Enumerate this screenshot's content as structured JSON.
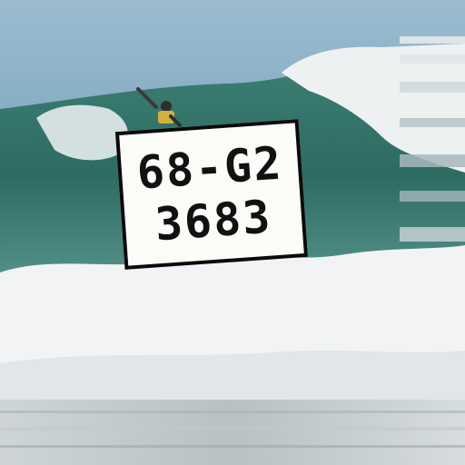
{
  "plate": {
    "line1": "68-G2",
    "line2": "3683"
  },
  "colors": {
    "sky": "#8fb3c9",
    "wave_dark": "#2f6f66",
    "wave_mid": "#4f8c84",
    "foam": "#f2f4f5",
    "plate_bg": "#fbfbf8",
    "plate_border": "#0b0b0b"
  }
}
